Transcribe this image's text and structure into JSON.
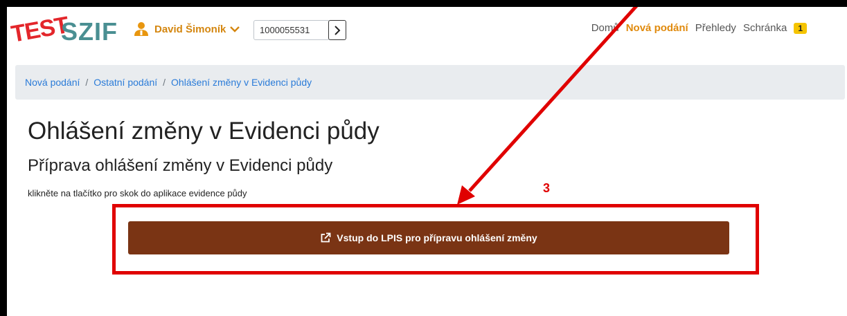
{
  "header": {
    "logo_test": "TEST",
    "logo_brand": "SZIF",
    "user_name": "David Šimoník",
    "id_value": "1000055531",
    "nav": [
      "Domů",
      "Nová podání",
      "Přehledy",
      "Schránka"
    ],
    "inbox_count": "1"
  },
  "breadcrumb": [
    "Nová podání",
    "Ostatní podání",
    "Ohlášení změny v Evidenci půdy"
  ],
  "main": {
    "title": "Ohlášení změny v Evidenci půdy",
    "subtitle": "Příprava ohlášení změny v Evidenci půdy",
    "hint": "klikněte na tlačítko pro skok do aplikace evidence půdy",
    "button_label": "Vstup do LPIS pro přípravu ohlášení změny"
  },
  "annotation": {
    "step_number": "3"
  },
  "colors": {
    "accent": "#e08a0d",
    "button": "#7a3414",
    "annotation": "#e00000",
    "link": "#2a7bd8"
  }
}
